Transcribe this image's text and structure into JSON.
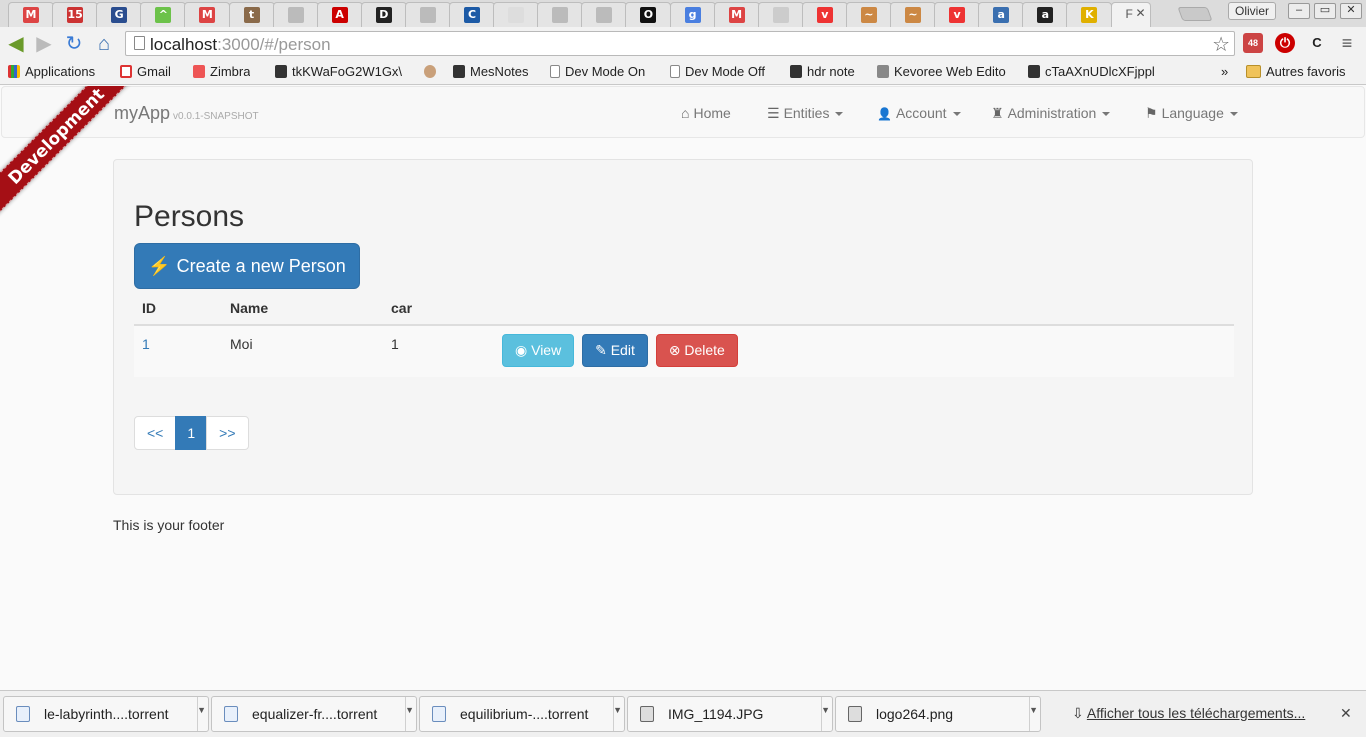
{
  "browser": {
    "profile_name": "Olivier",
    "active_tab_title": "F",
    "url_host": "localhost",
    "url_rest": ":3000/#/person",
    "tabs": [
      {
        "icon": "gmail-tab-icon",
        "glyph": "M",
        "color": "#d44"
      },
      {
        "icon": "calendar-tab-icon",
        "glyph": "15",
        "color": "#c33"
      },
      {
        "icon": "globe-tab-icon",
        "glyph": "G",
        "color": "#2a4d8f"
      },
      {
        "icon": "feedly-tab-icon",
        "glyph": "^",
        "color": "#6cc24a"
      },
      {
        "icon": "gmail-tab-icon",
        "glyph": "M",
        "color": "#d44"
      },
      {
        "icon": "tumblr-tab-icon",
        "glyph": "t",
        "color": "#8a6a4a"
      },
      {
        "icon": "page-tab-icon",
        "glyph": "",
        "color": "#bbb"
      },
      {
        "icon": "acrobat-tab-icon",
        "glyph": "A",
        "color": "#c00"
      },
      {
        "icon": "document-tab-icon",
        "glyph": "D",
        "color": "#222"
      },
      {
        "icon": "page-tab-icon",
        "glyph": "",
        "color": "#bbb"
      },
      {
        "icon": "app-tab-icon",
        "glyph": "C",
        "color": "#1c5aa6"
      },
      {
        "icon": "page-tab-icon",
        "glyph": "",
        "color": "#ddd"
      },
      {
        "icon": "page-tab-icon",
        "glyph": "",
        "color": "#bbb"
      },
      {
        "icon": "page-tab-icon",
        "glyph": "",
        "color": "#bbb"
      },
      {
        "icon": "dark-tab-icon",
        "glyph": "O",
        "color": "#111"
      },
      {
        "icon": "google-tab-icon",
        "glyph": "g",
        "color": "#4a7fe0"
      },
      {
        "icon": "gmail-tab-icon",
        "glyph": "M",
        "color": "#d44"
      },
      {
        "icon": "page-tab-icon",
        "glyph": "",
        "color": "#ccc"
      },
      {
        "icon": "pocket-tab-icon",
        "glyph": "v",
        "color": "#e33"
      },
      {
        "icon": "link-tab-icon",
        "glyph": "~",
        "color": "#c84"
      },
      {
        "icon": "link-tab-icon",
        "glyph": "~",
        "color": "#c84"
      },
      {
        "icon": "pocket-tab-icon",
        "glyph": "v",
        "color": "#e33"
      },
      {
        "icon": "app-tab-icon",
        "glyph": "a",
        "color": "#3a6fb0"
      },
      {
        "icon": "app-tab-icon",
        "glyph": "a",
        "color": "#222"
      },
      {
        "icon": "app-tab-icon",
        "glyph": "K",
        "color": "#e0b000"
      }
    ],
    "window_controls": [
      "–",
      "▭",
      "✕"
    ],
    "bookmarks": [
      {
        "label": "Applications",
        "icon": "apps-grid-icon"
      },
      {
        "label": "Gmail",
        "icon": "gmail-icon"
      },
      {
        "label": "Zimbra",
        "icon": "zimbra-icon"
      },
      {
        "label": "tkKWaFoG2W1Gx\\",
        "icon": "note-icon"
      },
      {
        "label": "",
        "icon": "face-icon"
      },
      {
        "label": "MesNotes",
        "icon": "note-icon"
      },
      {
        "label": "Dev Mode On",
        "icon": "page-icon"
      },
      {
        "label": "Dev Mode Off",
        "icon": "page-icon"
      },
      {
        "label": "hdr note",
        "icon": "note-icon"
      },
      {
        "label": "Kevoree Web Edito",
        "icon": "tool-icon"
      },
      {
        "label": "cTaAXnUDlcXFjppl",
        "icon": "note-icon"
      }
    ],
    "bookmarks_overflow": "»",
    "other_bookmarks": "Autres favoris"
  },
  "app": {
    "brand": "myApp",
    "version": "v0.0.1-SNAPSHOT",
    "ribbon": "Development",
    "nav": [
      {
        "label": "Home",
        "icon": "home-icon",
        "glyph": "⌂",
        "dropdown": false
      },
      {
        "label": "Entities",
        "icon": "list-icon",
        "glyph": "☰",
        "dropdown": true
      },
      {
        "label": "Account",
        "icon": "user-icon",
        "glyph": "👤",
        "dropdown": true
      },
      {
        "label": "Administration",
        "icon": "tower-icon",
        "glyph": "♜",
        "dropdown": true
      },
      {
        "label": "Language",
        "icon": "flag-icon",
        "glyph": "⚑",
        "dropdown": true
      }
    ],
    "page_title": "Persons",
    "create_button": "Create a new Person",
    "table": {
      "headers": [
        "ID",
        "Name",
        "car",
        ""
      ],
      "rows": [
        {
          "id": "1",
          "name": "Moi",
          "car": "1"
        }
      ]
    },
    "actions": {
      "view": "View",
      "edit": "Edit",
      "delete": "Delete"
    },
    "pager": {
      "prev": "<<",
      "current": "1",
      "next": ">>"
    },
    "footer": "This is your footer"
  },
  "downloads": {
    "items": [
      {
        "name": "le-labyrinth....torrent",
        "icon": "torrent-file-icon"
      },
      {
        "name": "equalizer-fr....torrent",
        "icon": "torrent-file-icon"
      },
      {
        "name": "equilibrium-....torrent",
        "icon": "torrent-file-icon"
      },
      {
        "name": "IMG_1194.JPG",
        "icon": "image-file-icon"
      },
      {
        "name": "logo264.png",
        "icon": "image-file-icon"
      }
    ],
    "show_all": "Afficher tous les téléchargements...",
    "close": "✕"
  },
  "colors": {
    "primary": "#337ab7",
    "info": "#5bc0de",
    "danger": "#d9534f",
    "ribbon": "#a50f15"
  }
}
